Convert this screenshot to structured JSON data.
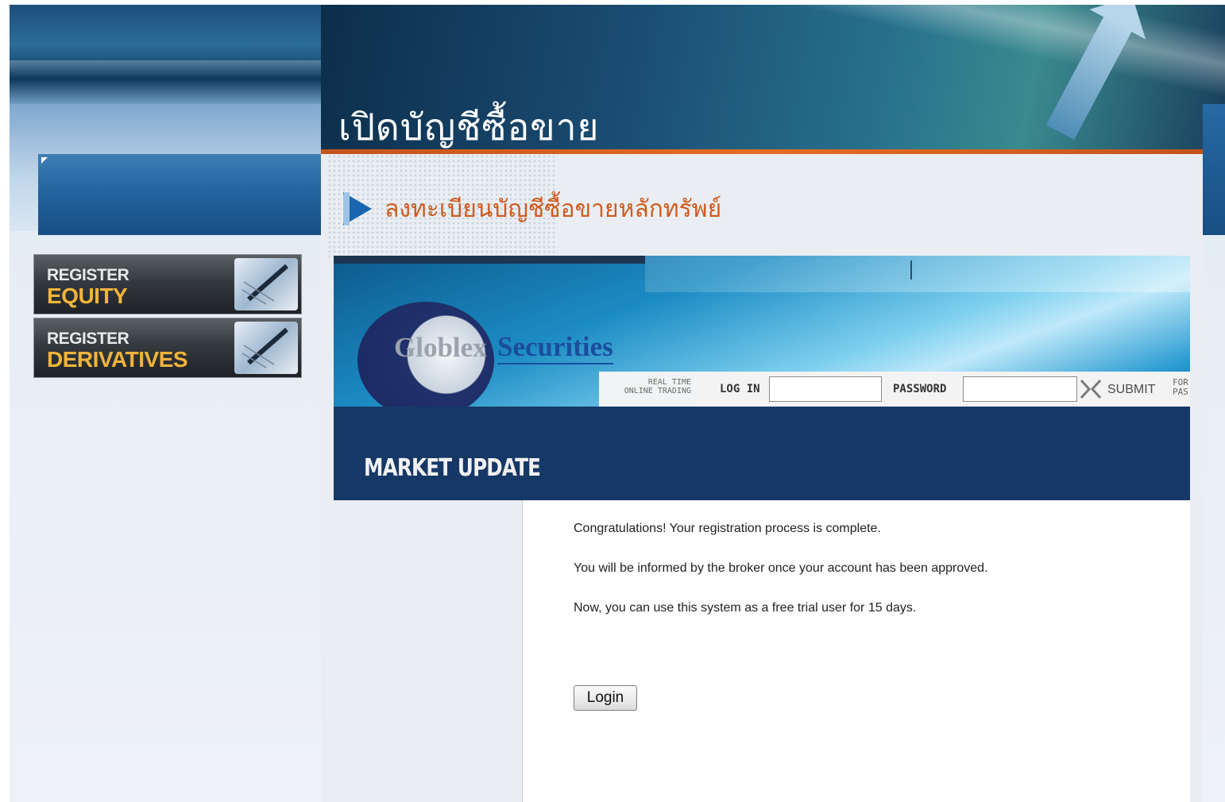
{
  "header": {
    "title": "เปิดบัญชีซื้อขาย"
  },
  "sidebar": {
    "buttons": [
      {
        "line1": "REGISTER",
        "line2": "EQUITY"
      },
      {
        "line1": "REGISTER",
        "line2": "DERIVATIVES"
      }
    ]
  },
  "content": {
    "heading": "ลงทะเบียนบัญชีซื้อขายหลักทรัพย์"
  },
  "banner": {
    "logo_part1": "Globlex",
    "logo_part2": "Securities",
    "realtime_line1": "REAL TIME",
    "realtime_line2": "ONLINE TRADING",
    "login_label": "LOG IN",
    "login_value": "",
    "password_label": "PASSWORD",
    "password_value": "",
    "submit_label": "SUBMIT",
    "forgot_line1": "FOR",
    "forgot_line2": "PAS"
  },
  "market": {
    "title": "MARKET UPDATE"
  },
  "messages": {
    "line1": "Congratulations! Your registration process is complete.",
    "line2": "You will be informed by the broker once your account has been approved.",
    "line3": "Now, you can use this system as a free trial user for 15 days.",
    "login_button": "Login"
  },
  "colors": {
    "heading_orange": "#d0591c",
    "market_bar_navy": "#163866",
    "register_gold": "#f0b43c"
  }
}
